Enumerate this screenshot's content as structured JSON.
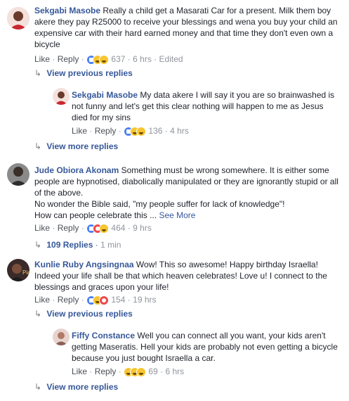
{
  "action_labels": {
    "like": "Like",
    "reply": "Reply",
    "dot": "·"
  },
  "comments": [
    {
      "author": "Sekgabi Masobe",
      "text": "Really a child get a Masarati Car for a present. Milk them boy akere they pay R25000 to receive your blessings and wena you buy your child an expensive car with their hard earned money and that time they don't even own a bicycle",
      "reaction_count": "637",
      "time": "6 hrs",
      "edited": "Edited",
      "reactions": [
        "like-icon",
        "haha-icon",
        "sad-icon"
      ]
    },
    {
      "author": "Sekgabi Masobe",
      "text": "My data akere I will say it you are so brainwashed is not funny and let's get this clear nothing will happen to me as Jesus died for my sins",
      "reaction_count": "136",
      "time": "4 hrs",
      "reactions": [
        "like-icon",
        "haha-icon",
        "sad-icon"
      ]
    },
    {
      "author": "Jude Obiora Akonam",
      "text": "Something must be wrong somewhere. It is either some people are hypnotised, diabolically manipulated or they are ignorantly stupid or all of the above.",
      "text2": "No wonder the Bible said, \"my people suffer for lack of knowledge\"!",
      "text3": "How can people celebrate this ...",
      "see_more": "See More",
      "reaction_count": "464",
      "time": "9 hrs",
      "reactions": [
        "like-icon",
        "love-icon",
        "haha-icon"
      ]
    },
    {
      "author": "Kunlie Ruby Angsingnaa",
      "text": "Wow! This so awesome! Happy birthday Israella! Indeed your life shall be that which heaven celebrates! Love u! I connect to the blessings and graces upon your life!",
      "reaction_count": "154",
      "time": "19 hrs",
      "reactions": [
        "like-icon",
        "haha-icon",
        "love-icon"
      ]
    },
    {
      "author": "Fiffy Constance",
      "text": "Well you can connect all you want, your kids aren't getting Maseratis. Hell your kids are probably not even getting a bicycle because you just bought Israella a car.",
      "reaction_count": "69",
      "time": "6 hrs",
      "reactions": [
        "haha-icon",
        "wow-icon",
        "sad-icon"
      ]
    }
  ],
  "links": {
    "view_previous_1": "View previous replies",
    "view_more_1": "View more replies",
    "replies_109": "109 Replies",
    "replies_time": "1 min",
    "view_previous_2": "View previous replies",
    "view_more_2": "View more replies"
  }
}
